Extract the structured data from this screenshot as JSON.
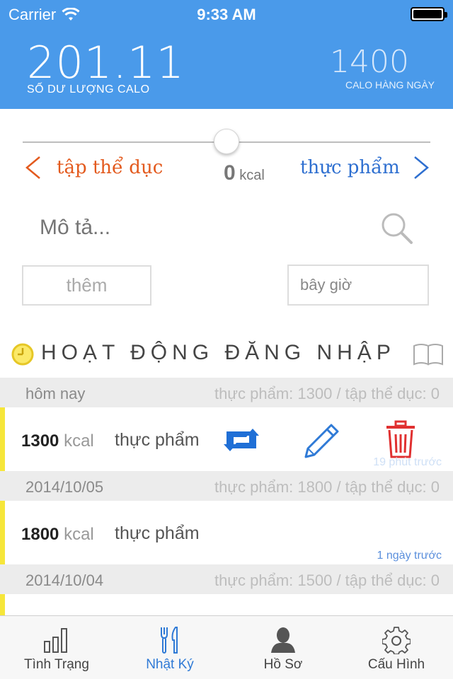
{
  "status_bar": {
    "carrier": "Carrier",
    "time": "9:33 AM"
  },
  "header": {
    "balance_value": "201.11",
    "balance_label": "SỐ DƯ LƯỢNG CALO",
    "daily_value": "1400",
    "daily_label": "CALO HÀNG NGÀY",
    "color": "#4a9aea"
  },
  "entry_form": {
    "slider_level": 0.5,
    "exercise_label": "tập thể dục",
    "food_label": "thực phẩm",
    "kcal_value": "0",
    "kcal_unit": "kcal",
    "description_placeholder": "Mô tả...",
    "add_label": "thêm",
    "time_value": "bây giờ"
  },
  "log": {
    "title": "HOẠT ĐỘNG ĐĂNG NHẬP",
    "days": [
      {
        "date": "hôm nay",
        "summary": "thực phẩm: 1300 / tập thể dục: 0",
        "entry": {
          "kcal": "1300",
          "unit": "kcal",
          "type": "thực phẩm",
          "ago": "19 phút trước"
        }
      },
      {
        "date": "2014/10/05",
        "summary": "thực phẩm: 1800 / tập thể dục: 0",
        "entry": {
          "kcal": "1800",
          "unit": "kcal",
          "type": "thực phẩm",
          "ago": "1 ngày trước"
        }
      },
      {
        "date": "2014/10/04",
        "summary": "thực phẩm: 1500 / tập thể dục: 0"
      }
    ],
    "row_actions": [
      {
        "icon": "repeat-icon",
        "color": "#1f6fd6"
      },
      {
        "icon": "pencil-icon",
        "color": "#2f7ad6"
      },
      {
        "icon": "trash-icon",
        "color": "#e03030"
      }
    ]
  },
  "tabbar": {
    "tabs": [
      {
        "label": "Tình Trạng",
        "icon": "bar-chart-icon"
      },
      {
        "label": "Nhật Ký",
        "icon": "fork-knife-icon",
        "active": true
      },
      {
        "label": "Hồ Sơ",
        "icon": "user-icon"
      },
      {
        "label": "Cấu Hình",
        "icon": "gear-icon"
      }
    ]
  }
}
